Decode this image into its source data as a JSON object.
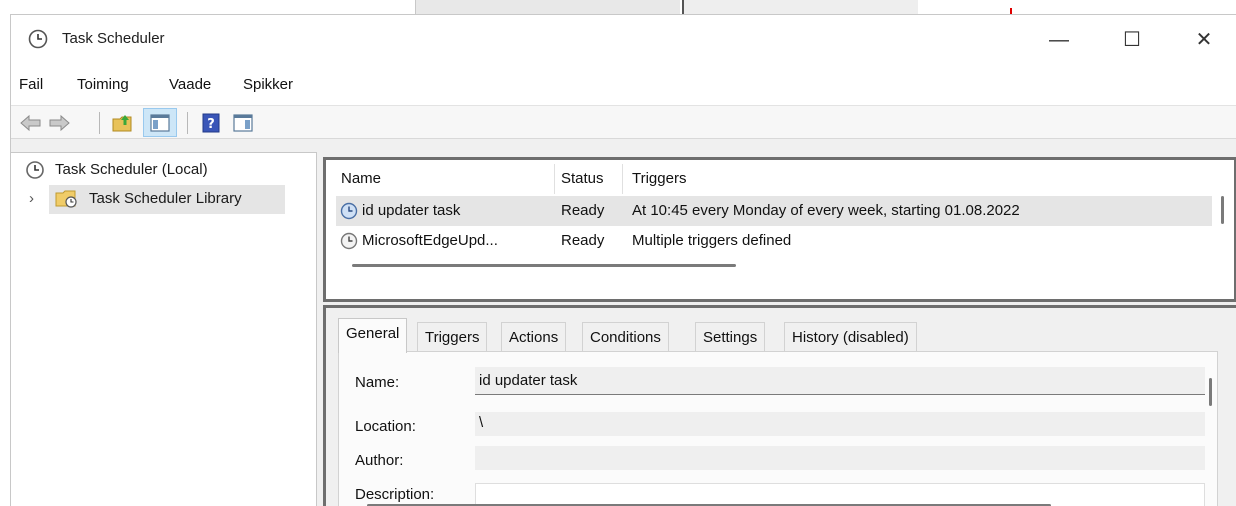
{
  "window": {
    "title": "Task Scheduler",
    "controls": {
      "minimize": "—",
      "maximize": "☐",
      "close": "✕"
    }
  },
  "menu": [
    "Fail",
    "Toiming",
    "Vaade",
    "Spikker"
  ],
  "toolbar": {
    "buttons": [
      "back-arrow-icon",
      "forward-arrow-icon",
      "up-folder-icon",
      "show-hide-console-tree-icon",
      "help-icon",
      "show-hide-action-pane-icon"
    ]
  },
  "tree": {
    "root": "Task Scheduler (Local)",
    "library": "Task Scheduler Library",
    "expander": "›"
  },
  "task_list": {
    "columns": [
      "Name",
      "Status",
      "Triggers"
    ],
    "rows": [
      {
        "name": "id updater task",
        "status": "Ready",
        "triggers": "At 10:45 every Monday of every week, starting 01.08.2022"
      },
      {
        "name": "MicrosoftEdgeUpd...",
        "status": "Ready",
        "triggers": "Multiple triggers defined"
      }
    ]
  },
  "details": {
    "tabs": [
      "General",
      "Triggers",
      "Actions",
      "Conditions",
      "Settings",
      "History (disabled)"
    ],
    "general": {
      "name_label": "Name:",
      "name_value": "id updater task",
      "location_label": "Location:",
      "location_value": "\\",
      "author_label": "Author:",
      "author_value": "",
      "description_label": "Description:"
    }
  },
  "colors": {
    "selection": "#e5e5e5",
    "toolbar_active": "#cde6f7",
    "frame": "#6e6e6e"
  }
}
